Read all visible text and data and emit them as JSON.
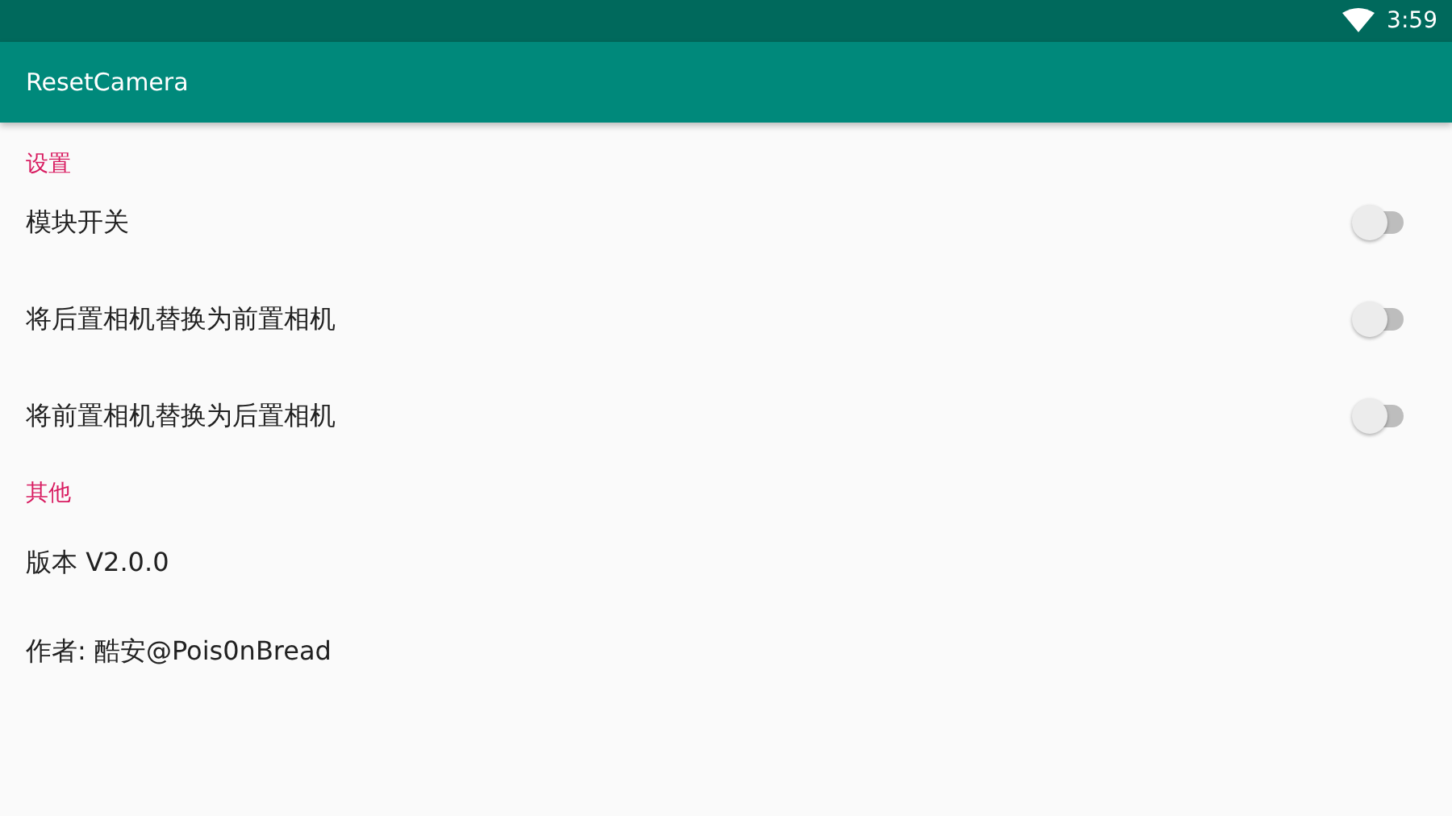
{
  "status_bar": {
    "time": "3:59"
  },
  "app_bar": {
    "title": "ResetCamera"
  },
  "sections": [
    {
      "title": "设置",
      "items": [
        {
          "kind": "switch",
          "label": "模块开关",
          "on": false
        },
        {
          "kind": "switch",
          "label": "将后置相机替换为前置相机",
          "on": false
        },
        {
          "kind": "switch",
          "label": "将前置相机替换为后置相机",
          "on": false
        }
      ]
    },
    {
      "title": "其他",
      "items": [
        {
          "kind": "text",
          "label": "版本 V2.0.0"
        },
        {
          "kind": "text",
          "label": "作者: 酷安@Pois0nBread"
        }
      ]
    }
  ]
}
